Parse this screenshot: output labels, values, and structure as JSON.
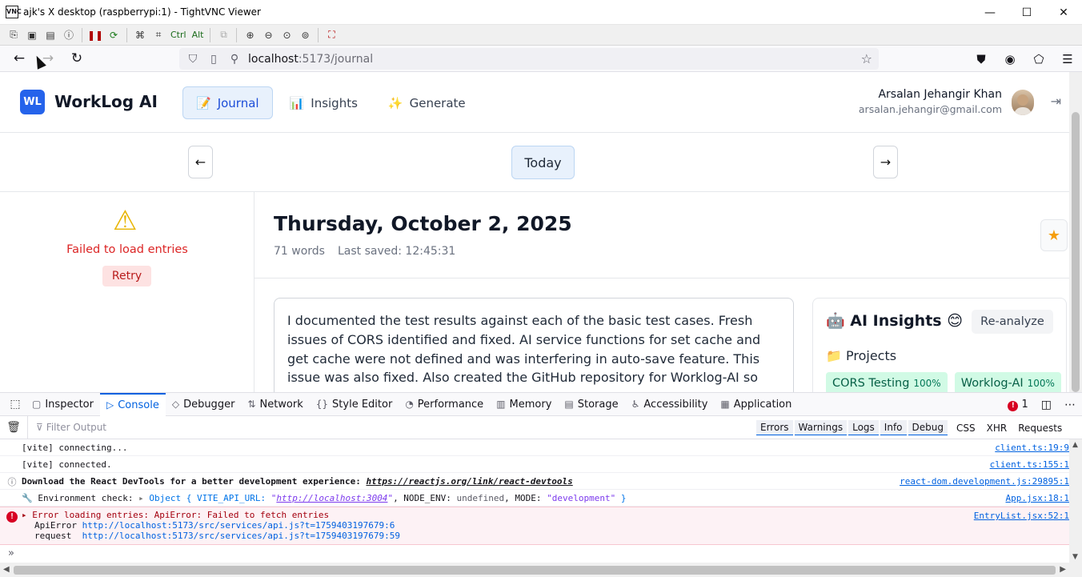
{
  "vnc": {
    "app_icon": "VNC",
    "title": "ajk's X desktop (raspberrypi:1) - TightVNC Viewer",
    "minimize": "—",
    "maximize": "☐",
    "close": "✕",
    "toolbar": {
      "ctrl": "Ctrl",
      "alt": "Alt"
    }
  },
  "browser": {
    "url_host": "localhost",
    "url_path": ":5173/journal"
  },
  "app": {
    "logo_badge": "WL",
    "logo_text": "WorkLog AI",
    "nav": [
      {
        "icon": "📝",
        "label": "Journal"
      },
      {
        "icon": "📊",
        "label": "Insights"
      },
      {
        "icon": "✨",
        "label": "Generate"
      }
    ],
    "user_name": "Arsalan Jehangir Khan",
    "user_email": "arsalan.jehangir@gmail.com",
    "date_nav": {
      "prev": "←",
      "today": "Today",
      "next": "→"
    },
    "left_panel": {
      "warning_icon": "⚠",
      "error_text": "Failed to load entries",
      "retry_label": "Retry"
    },
    "entry": {
      "date_title": "Thursday, October 2, 2025",
      "words": "71 words",
      "last_saved": "Last saved: 12:45:31",
      "text": "I documented the test results against each of the basic test cases. Fresh issues of CORS identified and fixed. AI service functions for set cache and get cache were not defined and was interfering in auto-save feature. This issue was also fixed. Also created the GitHub repository for Worklog-AI so"
    },
    "insights": {
      "title": "🤖 AI Insights 😊",
      "reanalyze_label": "Re-analyze",
      "projects_heading": "📁 Projects",
      "projects": [
        {
          "name": "CORS Testing",
          "pct": "100%"
        },
        {
          "name": "Worklog-AI",
          "pct": "100%"
        }
      ]
    }
  },
  "devtools": {
    "tabs": [
      {
        "icon": "▢",
        "label": "Inspector"
      },
      {
        "icon": "▷",
        "label": "Console"
      },
      {
        "icon": "◇",
        "label": "Debugger"
      },
      {
        "icon": "⇅",
        "label": "Network"
      },
      {
        "icon": "{}",
        "label": "Style Editor"
      },
      {
        "icon": "◔",
        "label": "Performance"
      },
      {
        "icon": "▥",
        "label": "Memory"
      },
      {
        "icon": "▤",
        "label": "Storage"
      },
      {
        "icon": "♿",
        "label": "Accessibility"
      },
      {
        "icon": "▦",
        "label": "Application"
      }
    ],
    "error_count": "1",
    "filter_placeholder": "Filter Output",
    "levels": [
      "Errors",
      "Warnings",
      "Logs",
      "Info",
      "Debug"
    ],
    "request_types": [
      "CSS",
      "XHR",
      "Requests"
    ],
    "messages": [
      {
        "text": "[vite] connecting...",
        "source": "client.ts:19:9"
      },
      {
        "text": "[vite] connected.",
        "source": "client.ts:155:1"
      },
      {
        "prefix": "Download the React DevTools for a better development experience: ",
        "link": "https://reactjs.org/link/react-devtools",
        "source": "react-dom.development.js:29895:1"
      },
      {
        "prefix": "🔧 Environment check: ",
        "object": "Object { VITE_API_URL: ",
        "api_url": "http://localhost:3004",
        "rest": ", NODE_ENV: ",
        "undefined": "undefined",
        "rest2": ", MODE: ",
        "mode": "\"development\"",
        "close": " }",
        "source": "App.jsx:18:1"
      }
    ],
    "error": {
      "message": "Error loading entries: ApiError: Failed to fetch entries",
      "source": "EntryList.jsx:52:1",
      "trace": [
        {
          "name": "ApiError",
          "location": "http://localhost:5173/src/services/api.js?t=1759403197679:6"
        },
        {
          "name": "request ",
          "location": "http://localhost:5173/src/services/api.js?t=1759403197679:59"
        }
      ]
    },
    "prompt": "»"
  }
}
